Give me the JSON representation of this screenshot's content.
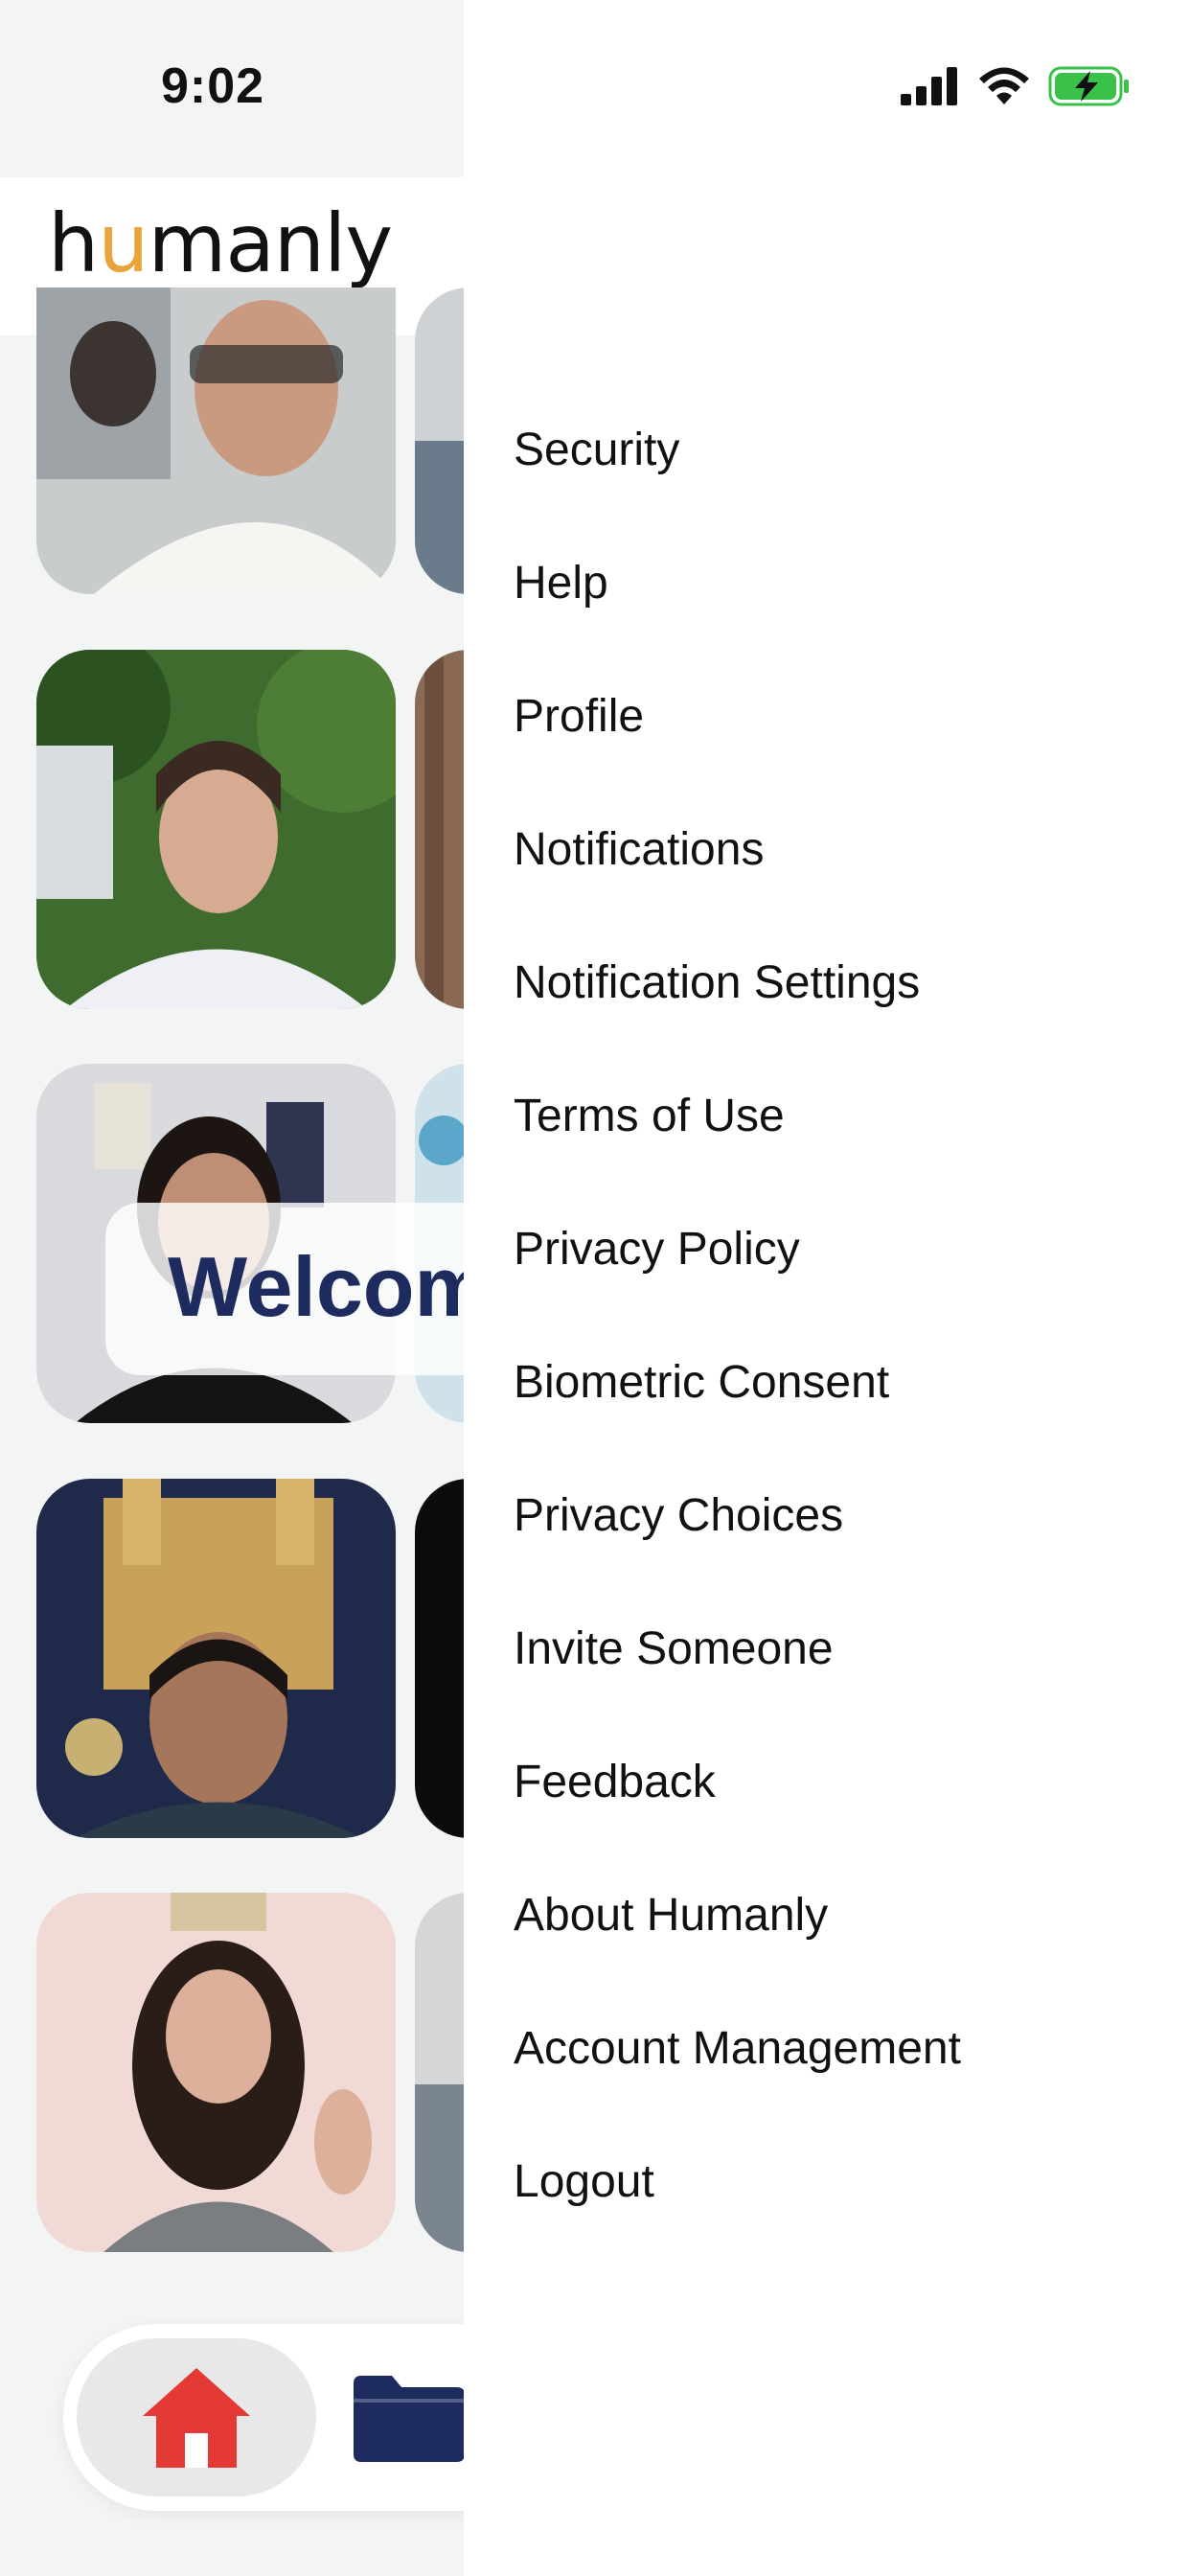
{
  "status_bar": {
    "time": "9:02"
  },
  "app": {
    "logo_first": "h",
    "logo_accent": "u",
    "logo_rest": "manly"
  },
  "feed": {
    "welcome_text": "Welcome"
  },
  "bottom_nav": {
    "home_icon": "home-icon",
    "folder_icon": "folder-icon"
  },
  "colors": {
    "accent": "#e8a33a",
    "brand_navy": "#1d2b5e",
    "home_red": "#e53935",
    "battery_green": "#3ac14a"
  },
  "menu": {
    "items": [
      {
        "label": "Security"
      },
      {
        "label": "Help"
      },
      {
        "label": "Profile"
      },
      {
        "label": "Notifications"
      },
      {
        "label": "Notification Settings"
      },
      {
        "label": "Terms of Use"
      },
      {
        "label": "Privacy Policy"
      },
      {
        "label": "Biometric Consent"
      },
      {
        "label": "Privacy Choices"
      },
      {
        "label": "Invite Someone"
      },
      {
        "label": "Feedback"
      },
      {
        "label": "About Humanly"
      },
      {
        "label": "Account Management"
      },
      {
        "label": "Logout"
      }
    ]
  }
}
